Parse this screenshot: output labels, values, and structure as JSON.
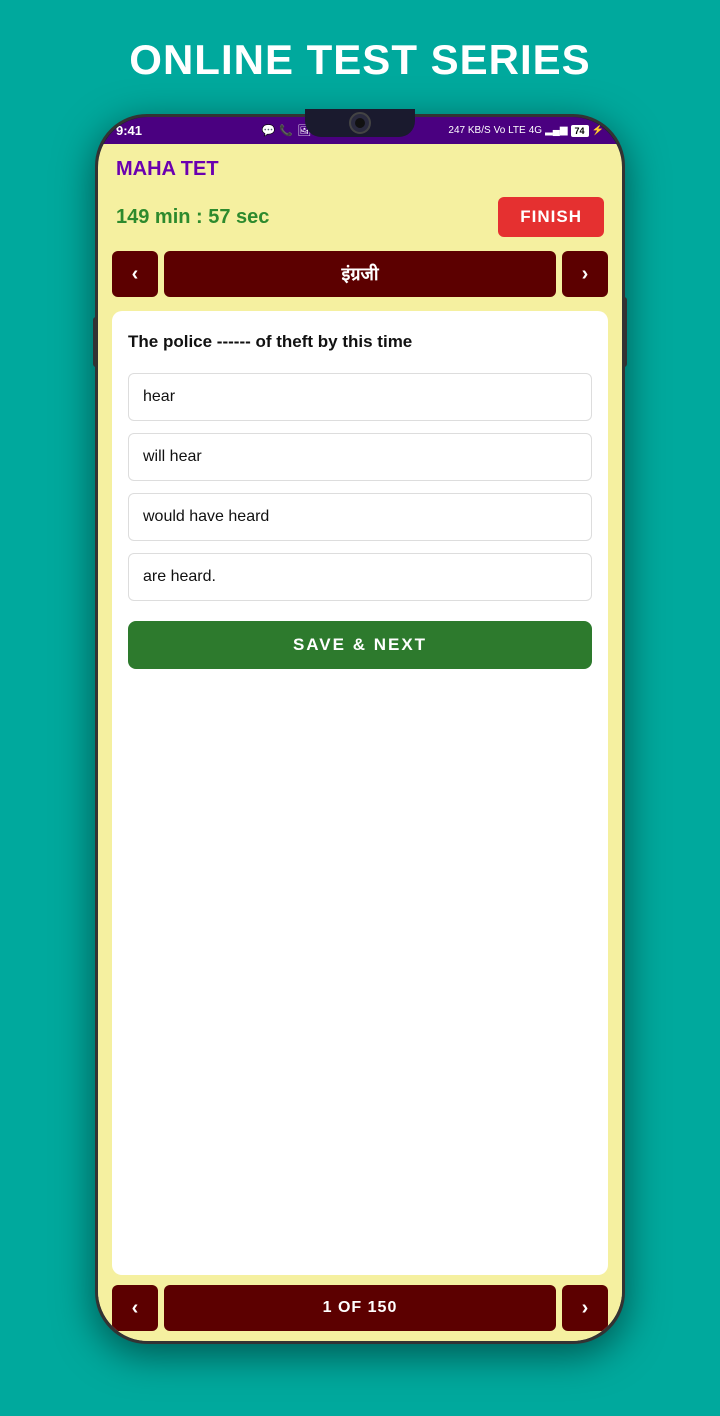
{
  "page": {
    "title": "ONLINE TEST SERIES",
    "bg_color": "#00a99d"
  },
  "status_bar": {
    "time": "9:41",
    "right_info": "247 KB/S  Vo LTE  4G  74",
    "battery": "74"
  },
  "app": {
    "name": "MAHA TET",
    "timer": "149 min : 57 sec",
    "finish_label": "FINISH",
    "subject": "इंग्रजी",
    "prev_label": "‹",
    "next_label": "›"
  },
  "question": {
    "text": "The police ------ of theft by this time",
    "options": [
      {
        "id": "A",
        "text": "hear"
      },
      {
        "id": "B",
        "text": "will hear"
      },
      {
        "id": "C",
        "text": "would have heard"
      },
      {
        "id": "D",
        "text": "are heard."
      }
    ],
    "save_next_label": "SAVE & NEXT"
  },
  "bottom_nav": {
    "prev_label": "‹",
    "counter": "1 OF 150",
    "next_label": "›"
  }
}
